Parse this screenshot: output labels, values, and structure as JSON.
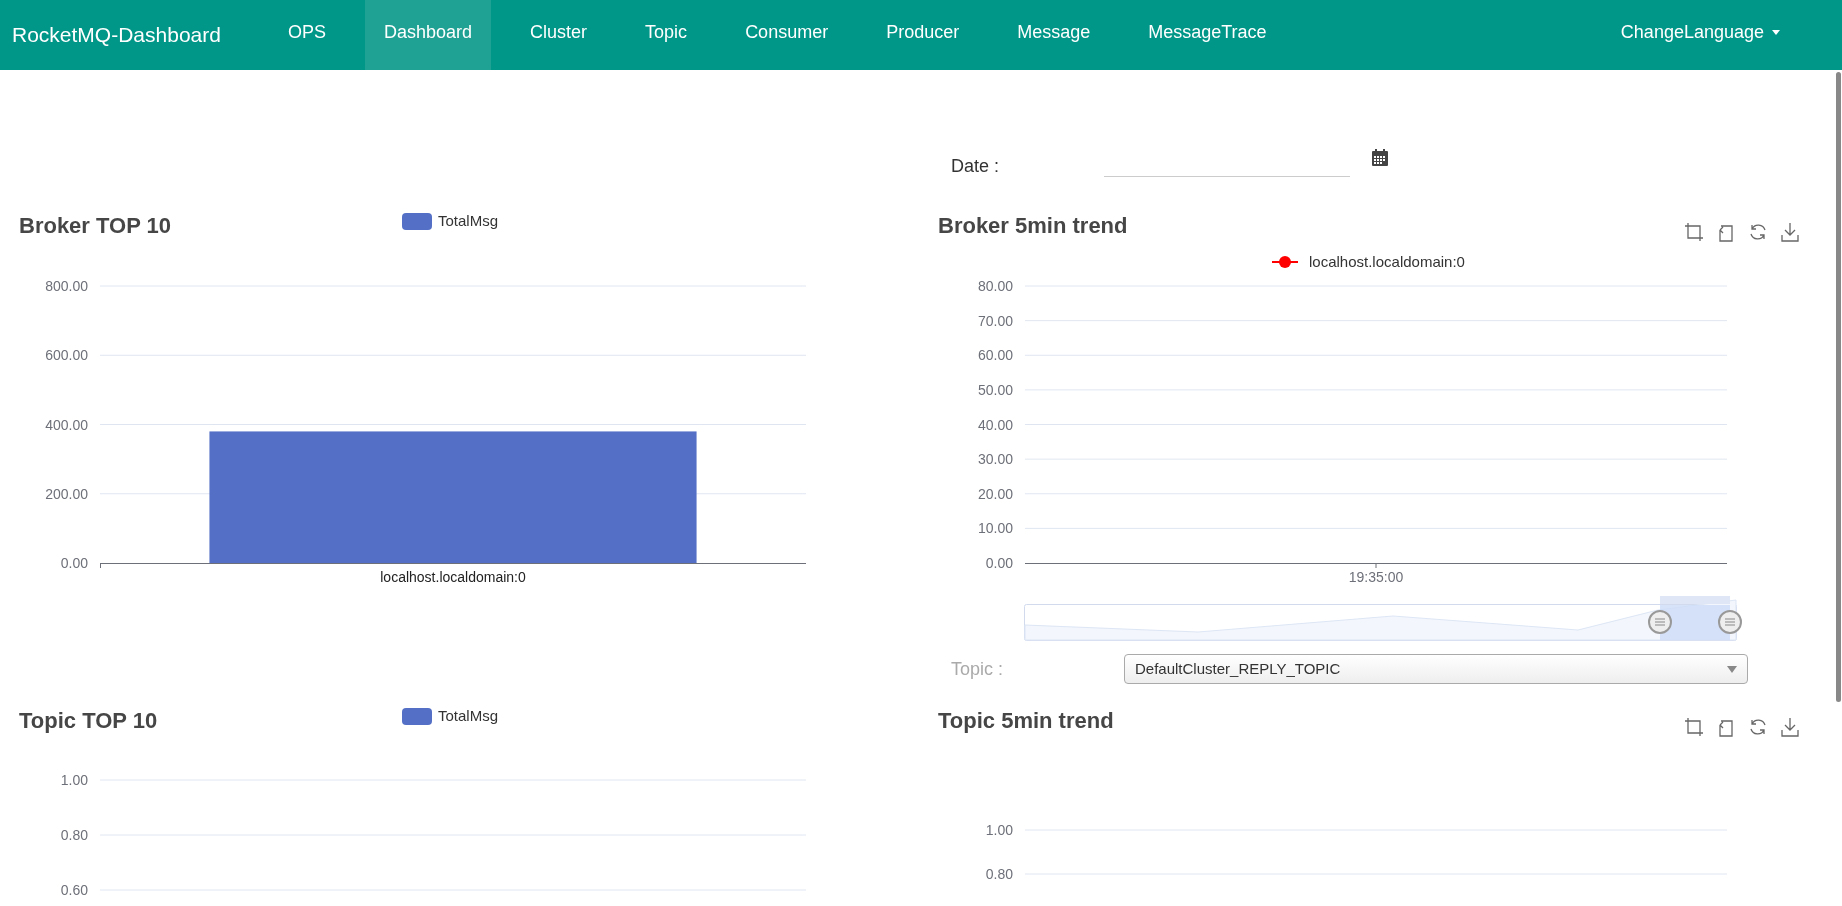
{
  "navbar": {
    "brand": "RocketMQ-Dashboard",
    "items": [
      {
        "label": "OPS",
        "selected": false
      },
      {
        "label": "Dashboard",
        "selected": true
      },
      {
        "label": "Cluster",
        "selected": false
      },
      {
        "label": "Topic",
        "selected": false
      },
      {
        "label": "Consumer",
        "selected": false
      },
      {
        "label": "Producer",
        "selected": false
      },
      {
        "label": "Message",
        "selected": false
      },
      {
        "label": "MessageTrace",
        "selected": false
      }
    ],
    "language_menu": "ChangeLanguage"
  },
  "date_filter": {
    "label": "Date :"
  },
  "broker_top10": {
    "title": "Broker TOP 10",
    "chart_data": {
      "type": "bar",
      "categories": [
        "localhost.localdomain:0"
      ],
      "series": [
        {
          "name": "TotalMsg",
          "color": "#5470c6",
          "values": [
            380
          ]
        }
      ],
      "grid": true,
      "ylim": [
        0,
        800
      ],
      "yticks": [
        {
          "value": 0,
          "label": "0.00"
        },
        {
          "value": 200,
          "label": "200.00"
        },
        {
          "value": 400,
          "label": "400.00"
        },
        {
          "value": 600,
          "label": "600.00"
        },
        {
          "value": 800,
          "label": "800.00"
        }
      ]
    }
  },
  "broker_trend": {
    "title": "Broker 5min trend",
    "chart_data": {
      "type": "line",
      "x": [
        "19:35:00"
      ],
      "series": [
        {
          "name": "localhost.localdomain:0",
          "color": "#ff0000",
          "values": [
            null
          ]
        }
      ],
      "grid": true,
      "ylim": [
        0,
        80
      ],
      "yticks": [
        {
          "value": 0,
          "label": "0.00"
        },
        {
          "value": 10,
          "label": "10.00"
        },
        {
          "value": 20,
          "label": "20.00"
        },
        {
          "value": 30,
          "label": "30.00"
        },
        {
          "value": 40,
          "label": "40.00"
        },
        {
          "value": 50,
          "label": "50.00"
        },
        {
          "value": 60,
          "label": "60.00"
        },
        {
          "value": 70,
          "label": "70.00"
        },
        {
          "value": 80,
          "label": "80.00"
        }
      ]
    },
    "topic_filter": {
      "label": "Topic :",
      "value": "DefaultCluster_REPLY_TOPIC"
    }
  },
  "topic_top10": {
    "title": "Topic TOP 10",
    "legend": [
      {
        "name": "TotalMsg",
        "color": "#5470c6"
      }
    ],
    "axis_labels": [
      "1.00",
      "0.80",
      "0.60"
    ]
  },
  "topic_trend": {
    "title": "Topic 5min trend",
    "axis_labels": [
      "1.00",
      "0.80"
    ]
  }
}
